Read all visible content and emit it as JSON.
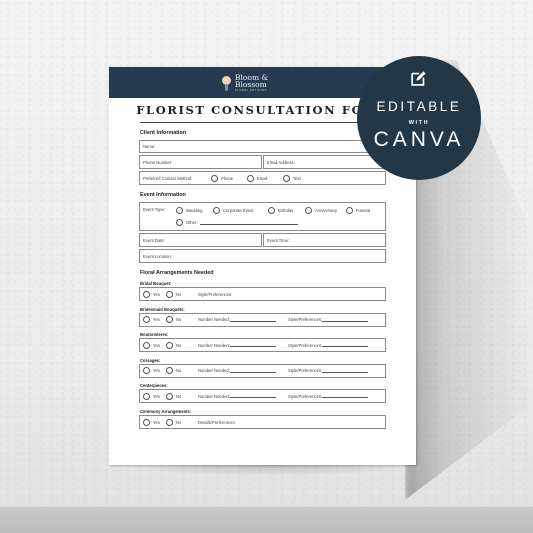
{
  "brand": {
    "name_line1": "Bloom &",
    "name_line2": "Blossom",
    "tagline": "FLORAL ARTISTRY",
    "header_color": "#263a52"
  },
  "document": {
    "title": "FLORIST CONSULTATION FORM"
  },
  "client_information": {
    "heading": "Client Information",
    "name_label": "Name:",
    "phone_label": "Phone Number:",
    "email_label": "Email Address:",
    "contact_method_label": "Preferred Contact Method:",
    "contact_options": [
      "Phone",
      "Email",
      "Text"
    ]
  },
  "event_information": {
    "heading": "Event Information",
    "event_type_label": "Event Type:",
    "event_type_options": [
      "Wedding",
      "Corporate Event",
      "Birthday",
      "Anniversary",
      "Funeral"
    ],
    "other_label": "Other:",
    "event_date_label": "Event Date:",
    "event_time_label": "Event Time:",
    "event_location_label": "Event Location:"
  },
  "floral_arrangements": {
    "heading": "Floral Arrangements Needed",
    "yes_label": "Yes",
    "no_label": "No",
    "items": [
      {
        "label": "Bridal Bouquet:",
        "number_label": "",
        "pref_label": "Style/Preferences:"
      },
      {
        "label": "Bridesmaid Bouquets:",
        "number_label": "Number Needed:",
        "pref_label": "Style/Preferences:"
      },
      {
        "label": "Boutonnieres:",
        "number_label": "Number Needed:",
        "pref_label": "Style/Preferences:"
      },
      {
        "label": "Corsages:",
        "number_label": "Number Needed:",
        "pref_label": "Style/Preferences:"
      },
      {
        "label": "Centerpieces:",
        "number_label": "Number Needed:",
        "pref_label": "Style/Preferences:"
      },
      {
        "label": "Ceremony Arrangements:",
        "number_label": "",
        "pref_label": "Details/Preferences:"
      }
    ]
  },
  "badge": {
    "icon": "edit-icon",
    "line1": "EDITABLE",
    "line2": "WITH",
    "line3": "CANVA",
    "color": "#233746"
  }
}
